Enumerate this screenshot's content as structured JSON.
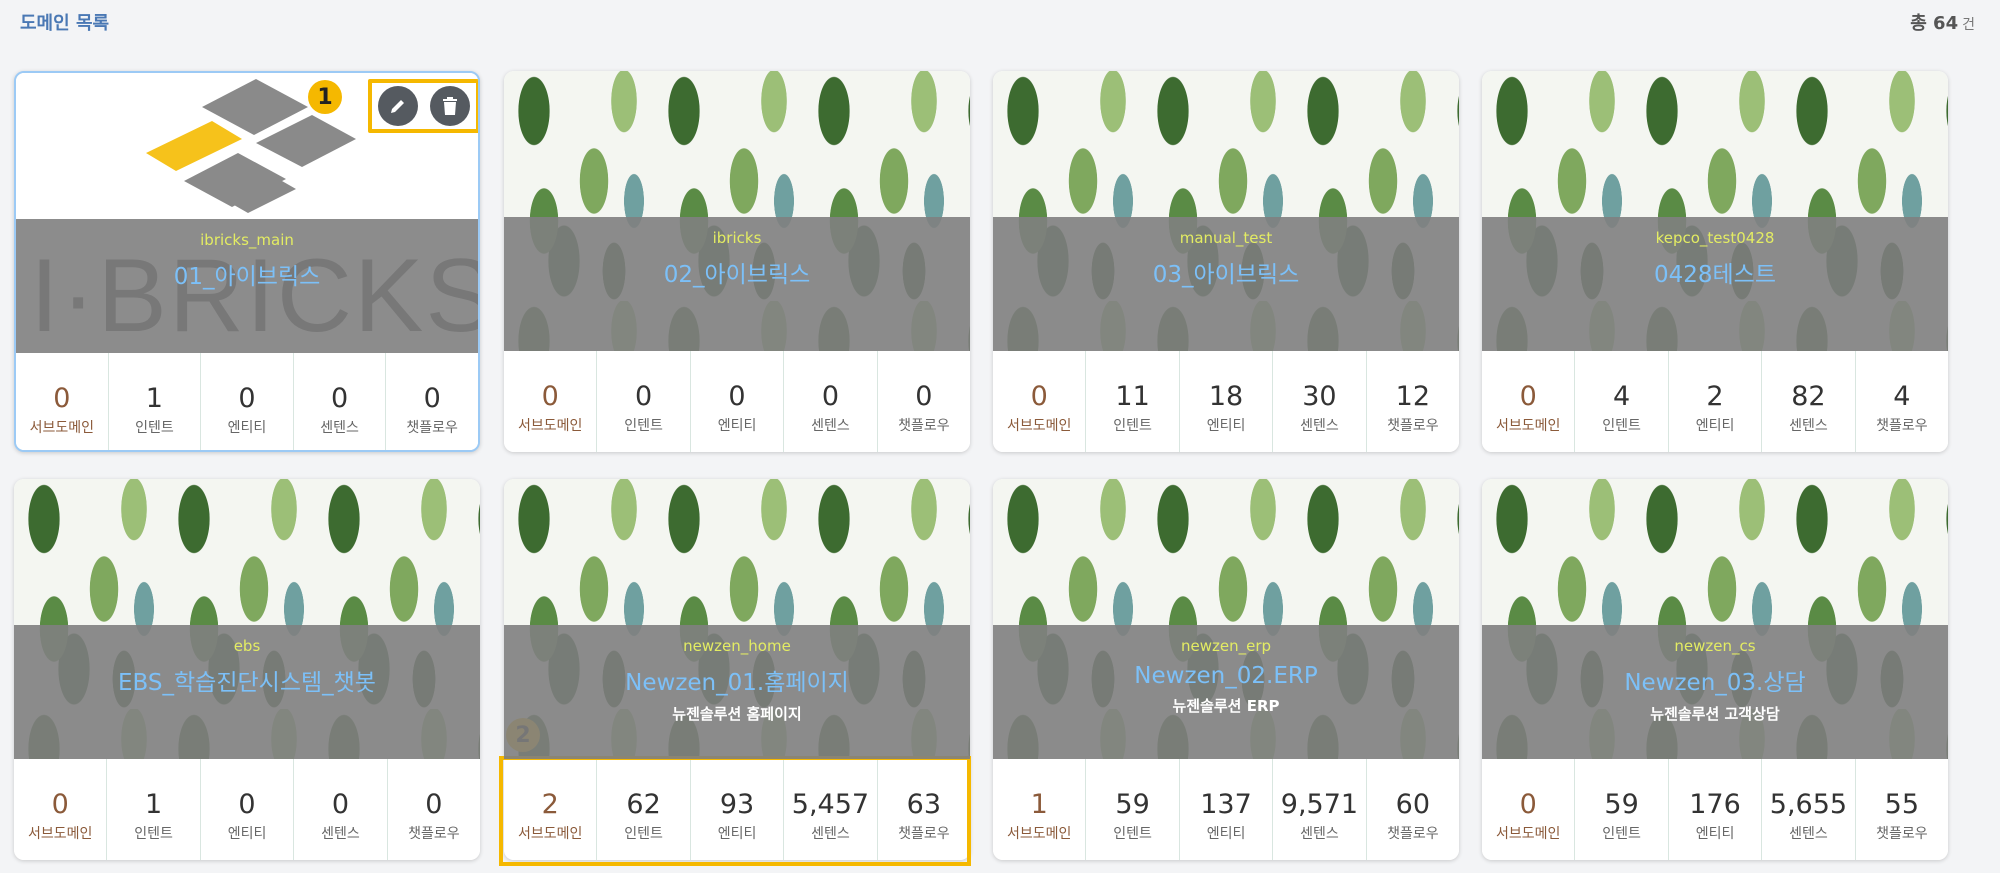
{
  "header": {
    "title": "도메인 목록",
    "total_prefix": "총",
    "total_count": "64",
    "total_unit": "건"
  },
  "stat_labels": [
    "서브도메인",
    "인텐트",
    "엔티티",
    "센텐스",
    "챗플로우"
  ],
  "logo": {
    "text": "I·BRICKS"
  },
  "markers": {
    "one": "1",
    "two": "2"
  },
  "cards": [
    {
      "code": "ibricks_main",
      "name": "01_아이브릭스",
      "desc": "",
      "stats": [
        "0",
        "1",
        "0",
        "0",
        "0"
      ]
    },
    {
      "code": "ibricks",
      "name": "02_아이브릭스",
      "desc": "",
      "stats": [
        "0",
        "0",
        "0",
        "0",
        "0"
      ]
    },
    {
      "code": "manual_test",
      "name": "03_아이브릭스",
      "desc": "",
      "stats": [
        "0",
        "11",
        "18",
        "30",
        "12"
      ]
    },
    {
      "code": "kepco_test0428",
      "name": "0428테스트",
      "desc": "",
      "stats": [
        "0",
        "4",
        "2",
        "82",
        "4"
      ]
    },
    {
      "code": "ebs",
      "name": "EBS_학습진단시스템_챗봇",
      "desc": "",
      "stats": [
        "0",
        "1",
        "0",
        "0",
        "0"
      ]
    },
    {
      "code": "newzen_home",
      "name": "Newzen_01.홈페이지",
      "desc": "뉴젠솔루션 홈페이지",
      "stats": [
        "2",
        "62",
        "93",
        "5,457",
        "63"
      ]
    },
    {
      "code": "newzen_erp",
      "name": "Newzen_02.ERP",
      "desc": "뉴젠솔루션 ERP",
      "stats": [
        "1",
        "59",
        "137",
        "9,571",
        "60"
      ]
    },
    {
      "code": "newzen_cs",
      "name": "Newzen_03.상담",
      "desc": "뉴젠솔루션 고객상담",
      "stats": [
        "0",
        "59",
        "176",
        "5,655",
        "55"
      ]
    }
  ]
}
